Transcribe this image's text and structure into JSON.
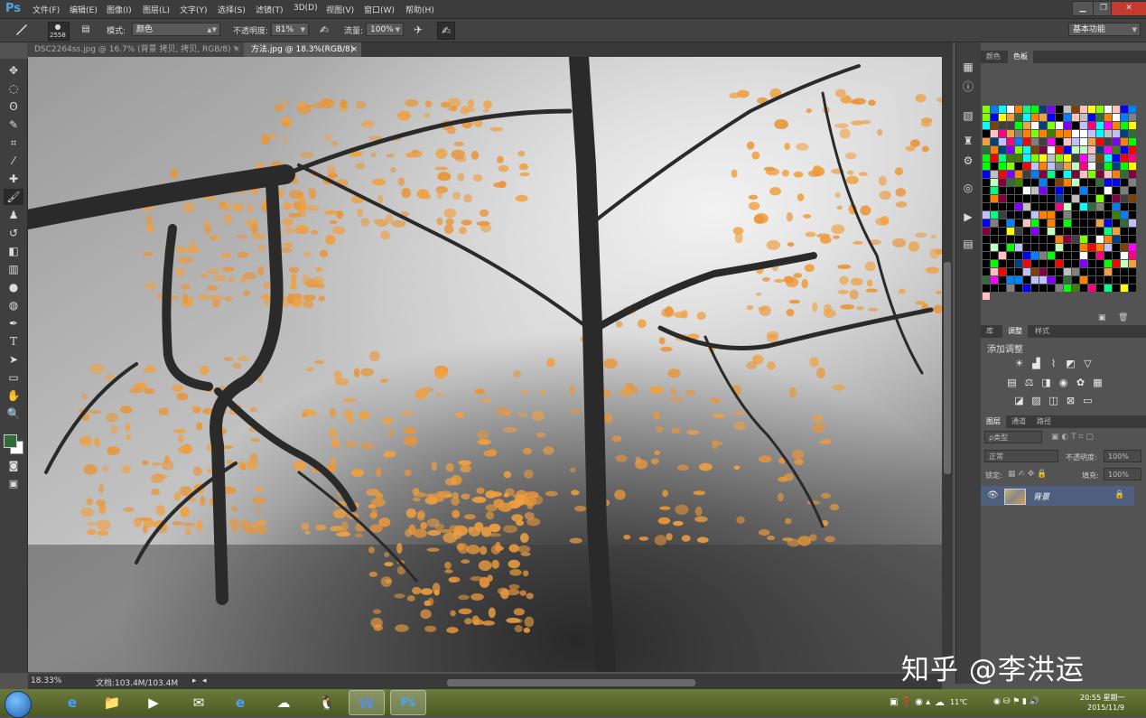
{
  "app": {
    "logo": "Ps"
  },
  "menu": [
    "文件(F)",
    "编辑(E)",
    "图像(I)",
    "图层(L)",
    "文字(Y)",
    "选择(S)",
    "滤镜(T)",
    "3D(D)",
    "视图(V)",
    "窗口(W)",
    "帮助(H)"
  ],
  "window_controls": {
    "minimize": "▁",
    "restore": "❐",
    "close": "✕"
  },
  "options": {
    "brush_size": "2558",
    "mode_label": "模式:",
    "mode_value": "颜色",
    "opacity_label": "不透明度:",
    "opacity_value": "81%",
    "flow_label": "流量:",
    "flow_value": "100%",
    "workspace": "基本功能"
  },
  "tabs": [
    {
      "label": "DSC2264ss.jpg @ 16.7% (背景 拷贝, 拷贝, RGB/8) *",
      "close": "×",
      "active": false
    },
    {
      "label": "方法.jpg @ 18.3%(RGB/8)",
      "close": "×",
      "active": true
    }
  ],
  "status": {
    "zoom": "18.33%",
    "doc": "文档:103.4M/103.4M"
  },
  "panels": {
    "swatch_tabs": [
      "颜色",
      "色板"
    ],
    "adjust_tabs": [
      "库",
      "调整",
      "样式"
    ],
    "adjust_title": "添加调整",
    "layer_tabs": [
      "图层",
      "通道",
      "路径"
    ],
    "kind_filter": "ρ类型",
    "blend_mode": "正常",
    "opacity_label": "不透明度:",
    "opacity_value": "100%",
    "lock_label": "锁定:",
    "fill_label": "填充:",
    "fill_value": "100%",
    "layer_name": "背景"
  },
  "taskbar": {
    "temperature": "11℃",
    "time": "20:55 星期一",
    "date": "2015/11/9"
  },
  "watermark": "知乎 @李洪运",
  "colors": {
    "foreground": "#2f6e3a",
    "background": "#ffffff",
    "accent_orange": "#f0a040"
  },
  "icons": {
    "tools": [
      "move-icon",
      "marquee-icon",
      "lasso-icon",
      "quick-select-icon",
      "crop-icon",
      "eyedropper-icon",
      "healing-icon",
      "brush-icon",
      "stamp-icon",
      "history-brush-icon",
      "eraser-icon",
      "gradient-icon",
      "blur-icon",
      "dodge-icon",
      "pen-icon",
      "type-icon",
      "path-select-icon",
      "shape-icon",
      "hand-icon",
      "zoom-icon"
    ]
  }
}
